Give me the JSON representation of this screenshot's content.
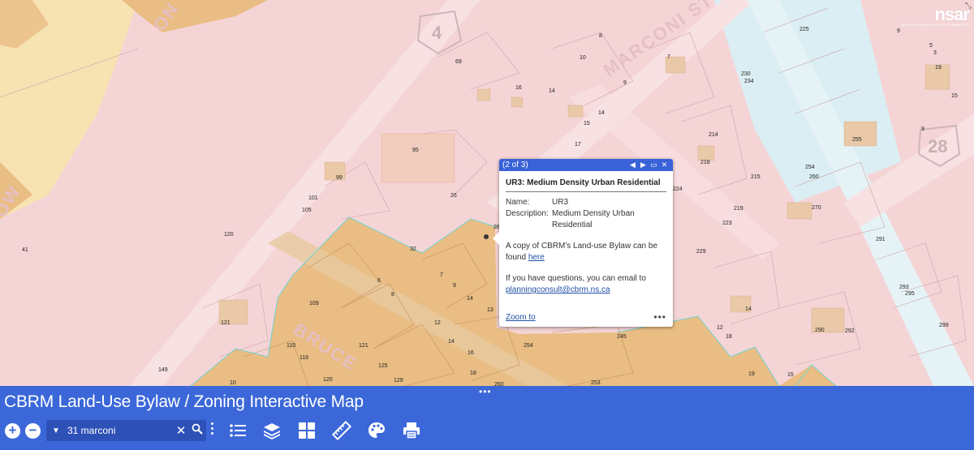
{
  "app": {
    "title": "CBRM Land-Use Bylaw / Zoning Interactive Map"
  },
  "logo": {
    "text": "nsar",
    "subtitle": "NOVA SCOTIA ASSOCIATION OF REALTORS"
  },
  "map": {
    "road_labels": [
      "MARCONI ST",
      "BRUCE",
      "OW",
      "ON"
    ],
    "route_shields": [
      "4",
      "28"
    ],
    "parcel_numbers": [
      "225",
      "9",
      "5",
      "3",
      "19",
      "15",
      "8",
      "10",
      "7",
      "69",
      "9",
      "16",
      "14",
      "230",
      "234",
      "14",
      "15",
      "17",
      "214",
      "9",
      "255",
      "95",
      "218",
      "254",
      "260",
      "99",
      "101",
      "105",
      "26",
      "224",
      "215",
      "219",
      "270",
      "28",
      "223",
      "291",
      "120",
      "41",
      "32",
      "229",
      "6",
      "7",
      "9",
      "8",
      "14",
      "13",
      "109",
      "293",
      "295",
      "121",
      "12",
      "14",
      "14",
      "12",
      "18",
      "290",
      "292",
      "299",
      "110",
      "116",
      "121",
      "16",
      "245",
      "254",
      "125",
      "149",
      "18",
      "19",
      "15",
      "10",
      "120",
      "129",
      "260",
      "253"
    ],
    "colors": {
      "residential_pink": "#f5d4d6",
      "commercial_tan": "#e9bd83",
      "institutional_blue": "#dbeef3",
      "yellow_zone": "#f7e2b2"
    }
  },
  "popup": {
    "count": "(2 of 3)",
    "prev_icon": "triangle-left-icon",
    "next_icon": "triangle-right-icon",
    "maximize_icon": "maximize-icon",
    "close_icon": "close-icon",
    "title": "UR3: Medium Density Urban Residential",
    "fields": [
      {
        "key": "Name:",
        "value": "UR3"
      },
      {
        "key": "Description:",
        "value": "Medium Density Urban Residential"
      }
    ],
    "bylaw_text": "A copy of CBRM's Land-use Bylaw can be found",
    "bylaw_link": "here",
    "contact_text": "If you have questions, you can email to",
    "contact_link": "planningconsult@cbrm.ns.ca",
    "zoom_link": "Zoom to",
    "more": "•••"
  },
  "toolbar": {
    "zoom_in": "+",
    "zoom_out": "−",
    "search_value": "31 marconi",
    "grip": "•••",
    "tools": [
      "legend-list-icon",
      "layers-icon",
      "basemap-grid-icon",
      "measure-ruler-icon",
      "palette-icon",
      "print-icon"
    ]
  }
}
